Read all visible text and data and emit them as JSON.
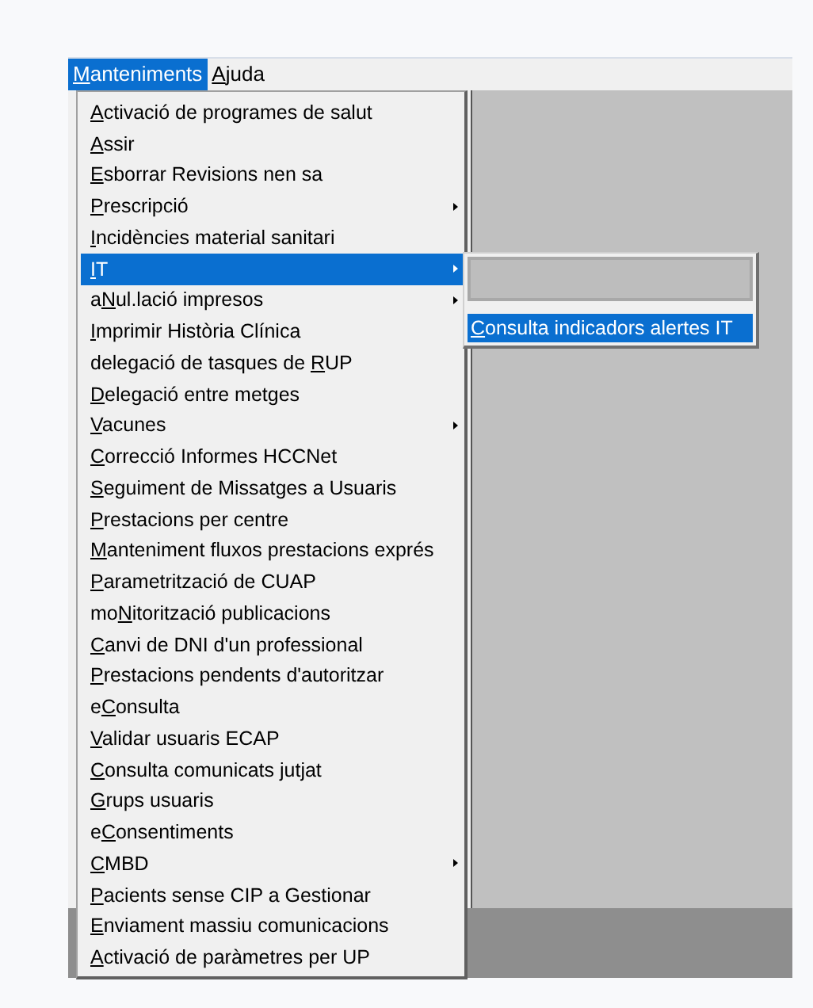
{
  "menu_bar": [
    {
      "key": "M",
      "after": "anteniments",
      "selected": true
    },
    {
      "key": "A",
      "after": "juda",
      "selected": false
    }
  ],
  "menu": {
    "items": [
      {
        "key": "A",
        "after": "ctivació de programes de salut",
        "submenu": false,
        "selected": false
      },
      {
        "key": "A",
        "after": "ssir",
        "submenu": false,
        "selected": false
      },
      {
        "key": "E",
        "after": "sborrar Revisions nen sa",
        "submenu": false,
        "selected": false
      },
      {
        "key": "P",
        "after": "rescripció",
        "submenu": true,
        "selected": false
      },
      {
        "key": "I",
        "after": "ncidències material sanitari",
        "submenu": false,
        "selected": false
      },
      {
        "key": "I",
        "after": "T",
        "submenu": true,
        "selected": true
      },
      {
        "before": "a",
        "key": "N",
        "after": "ul.lació impresos",
        "submenu": true,
        "selected": false
      },
      {
        "key": "I",
        "after": "mprimir Història Clínica",
        "submenu": false,
        "selected": false
      },
      {
        "before": "delegació de tasques de ",
        "key": "R",
        "after": "UP",
        "submenu": false,
        "selected": false
      },
      {
        "key": "D",
        "after": "elegació entre metges",
        "submenu": false,
        "selected": false
      },
      {
        "key": "V",
        "after": "acunes",
        "submenu": true,
        "selected": false
      },
      {
        "key": "C",
        "after": "orrecció Informes HCCNet",
        "submenu": false,
        "selected": false
      },
      {
        "key": "S",
        "after": "eguiment de Missatges a Usuaris",
        "submenu": false,
        "selected": false
      },
      {
        "key": "P",
        "after": "restacions per centre",
        "submenu": false,
        "selected": false
      },
      {
        "key": "M",
        "after": "anteniment fluxos prestacions exprés",
        "submenu": false,
        "selected": false
      },
      {
        "key": "P",
        "after": "arametrització de CUAP",
        "submenu": false,
        "selected": false
      },
      {
        "before": "mo",
        "key": "N",
        "after": "itorització publicacions",
        "submenu": false,
        "selected": false
      },
      {
        "key": "C",
        "after": "anvi de DNI d'un professional",
        "submenu": false,
        "selected": false
      },
      {
        "key": "P",
        "after": "restacions pendents d'autoritzar",
        "submenu": false,
        "selected": false
      },
      {
        "before": "e",
        "key": "C",
        "after": "onsulta",
        "submenu": false,
        "selected": false
      },
      {
        "key": "V",
        "after": "alidar usuaris ECAP",
        "submenu": false,
        "selected": false
      },
      {
        "key": "C",
        "after": "onsulta comunicats jutjat",
        "submenu": false,
        "selected": false
      },
      {
        "key": "G",
        "after": "rups usuaris",
        "submenu": false,
        "selected": false
      },
      {
        "before": "e",
        "key": "C",
        "after": "onsentiments",
        "submenu": false,
        "selected": false
      },
      {
        "key": "C",
        "after": "MBD",
        "submenu": true,
        "selected": false
      },
      {
        "key": "P",
        "after": "acients sense CIP a Gestionar",
        "submenu": false,
        "selected": false
      },
      {
        "key": "E",
        "after": "nviament massiu comunicacions",
        "submenu": false,
        "selected": false
      },
      {
        "key": "A",
        "after": "ctivació de paràmetres per UP",
        "submenu": false,
        "selected": false
      }
    ]
  },
  "submenu": {
    "items": [
      {
        "kind": "blank",
        "selected": false
      },
      {
        "kind": "text",
        "key": "C",
        "after": "onsulta indicadors alertes IT",
        "selected": true
      }
    ]
  }
}
